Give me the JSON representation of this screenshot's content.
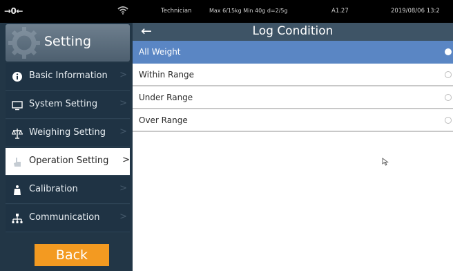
{
  "status_bar": {
    "scale_indicator": "→0←",
    "user": "Technician",
    "specs": "Max 6/15kg  Min 40g  d=2/5g",
    "code": "A1.27",
    "datetime": "2019/08/06 13:2"
  },
  "sidebar": {
    "title": "Setting",
    "items": [
      {
        "label": "Basic Information",
        "icon": "info-icon",
        "active": false
      },
      {
        "label": "System Setting",
        "icon": "monitor-icon",
        "active": false
      },
      {
        "label": "Weighing Setting",
        "icon": "scale-icon",
        "active": false
      },
      {
        "label": "Operation Setting",
        "icon": "hand-icon",
        "active": true
      },
      {
        "label": "Calibration",
        "icon": "weight-icon",
        "active": false
      },
      {
        "label": "Communication",
        "icon": "network-icon",
        "active": false
      }
    ],
    "chevron": ">",
    "back_label": "Back"
  },
  "main": {
    "back_arrow": "←",
    "title": "Log Condition",
    "options": [
      {
        "label": "All Weight",
        "selected": true
      },
      {
        "label": "Within Range",
        "selected": false
      },
      {
        "label": "Under Range",
        "selected": false
      },
      {
        "label": "Over Range",
        "selected": false
      }
    ]
  },
  "colors": {
    "sidebar_bg": "#223646",
    "topbar_bg": "#3e5466",
    "selected_row": "#5a86c4",
    "back_button": "#f39a21"
  }
}
